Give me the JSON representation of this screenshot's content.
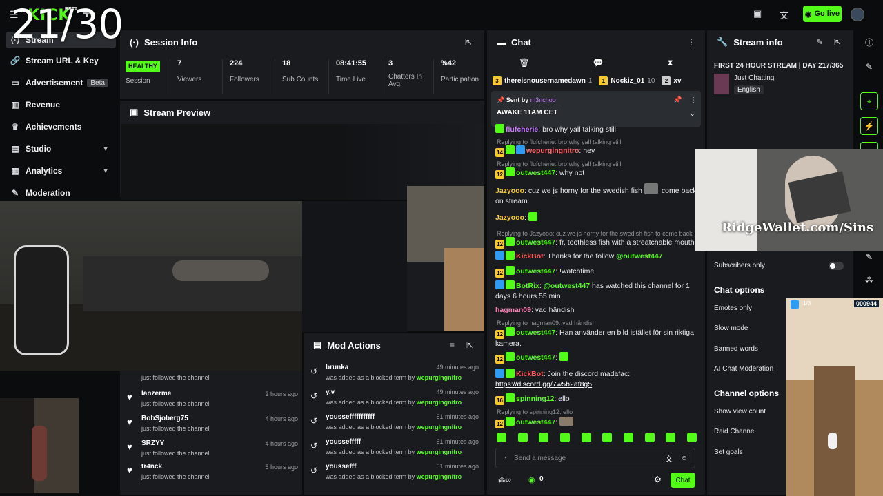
{
  "topbar": {
    "logo": "KICK",
    "beta": "BETA",
    "go_live": "Go live"
  },
  "overlay_counter": "21/30",
  "sidebar": {
    "items": [
      {
        "label": "Stream",
        "icon": "stream-icon"
      },
      {
        "label": "Stream URL & Key",
        "icon": "link-icon"
      },
      {
        "label": "Advertisement",
        "icon": "ad-icon",
        "badge": "Beta"
      },
      {
        "label": "Revenue",
        "icon": "chart-icon"
      },
      {
        "label": "Achievements",
        "icon": "trophy-icon"
      },
      {
        "label": "Studio",
        "icon": "studio-icon"
      },
      {
        "label": "Analytics",
        "icon": "analytics-icon"
      },
      {
        "label": "Moderation",
        "icon": "moderation-icon"
      }
    ]
  },
  "session": {
    "title": "Session Info",
    "status": "HEALTHY",
    "stats": [
      {
        "value": "",
        "label": "Session"
      },
      {
        "value": "7",
        "label": "Viewers"
      },
      {
        "value": "224",
        "label": "Followers"
      },
      {
        "value": "18",
        "label": "Sub Counts"
      },
      {
        "value": "08:41:55",
        "label": "Time Live"
      },
      {
        "value": "3",
        "label": "Chatters In Avg."
      },
      {
        "value": "%42",
        "label": "Participation"
      }
    ]
  },
  "preview": {
    "title": "Stream Preview"
  },
  "follows": [
    {
      "name": "",
      "sub": "just followed the channel",
      "time": ""
    },
    {
      "name": "lanzerme",
      "sub": "just followed the channel",
      "time": "2 hours ago"
    },
    {
      "name": "BobSjoberg75",
      "sub": "just followed the channel",
      "time": "4 hours ago"
    },
    {
      "name": "SRZYY",
      "sub": "just followed the channel",
      "time": "4 hours ago"
    },
    {
      "name": "tr4nck",
      "sub": "just followed the channel",
      "time": "5 hours ago"
    }
  ],
  "mod_actions": {
    "title": "Mod Actions",
    "items": [
      {
        "term": "brunka",
        "desc": "was added as a blocked term by",
        "by": "wepurgingnitro",
        "time": "49 minutes ago"
      },
      {
        "term": "y.v",
        "desc": "was added as a blocked term by",
        "by": "wepurgingnitro",
        "time": "49 minutes ago"
      },
      {
        "term": "youssefffffffffff",
        "desc": "was added as a blocked term by",
        "by": "wepurgingnitro",
        "time": "51 minutes ago"
      },
      {
        "term": "youssefffff",
        "desc": "was added as a blocked term by",
        "by": "wepurgingnitro",
        "time": "51 minutes ago"
      },
      {
        "term": "youssefff",
        "desc": "was added as a blocked term by",
        "by": "wepurgingnitro",
        "time": "51 minutes ago"
      }
    ]
  },
  "chat": {
    "title": "Chat",
    "gifters": [
      {
        "name": "thereisnousernamedawn",
        "count": "1"
      },
      {
        "name": "Nockiz_01",
        "count": "10"
      },
      {
        "name": "xv",
        "count": ""
      }
    ],
    "pinned": {
      "sent_by": "Sent by",
      "user": "m3nchoo",
      "text": "AWAKE 11AM CET"
    },
    "messages": [
      {
        "user": "flufcherie",
        "text": "bro why yall talking still",
        "reply": ""
      },
      {
        "user": "wepurgingnitro",
        "text": "hey",
        "reply": "Replying to flufcherie: bro why yall talking still"
      },
      {
        "user": "outwest447",
        "text": "why not",
        "reply": "Replying to flufcherie: bro why yall talking still"
      },
      {
        "user": "Jazyooo",
        "text": "cuz we js horny for the swedish fish",
        "text2": "come back on stream",
        "reply": ""
      },
      {
        "user": "Jazyooo",
        "text": "",
        "reply": ""
      },
      {
        "user": "outwest447",
        "text": "fr, toothless fish with a streatchable mouth",
        "reply": "Replying to Jazyooo: cuz we js horny for the swedish fish to come back"
      },
      {
        "user": "KickBot",
        "text": "Thanks for the follow",
        "mention": "@outwest447",
        "reply": ""
      },
      {
        "user": "outwest447",
        "text": "!watchtime",
        "reply": ""
      },
      {
        "user": "BotRix",
        "text": "has watched this channel for 1 days 6 hours 55 min.",
        "mention": "@outwest447",
        "reply": ""
      },
      {
        "user": "hagman09",
        "text": "vad händish",
        "reply": ""
      },
      {
        "user": "outwest447",
        "text": "Han använder en bild istället för sin riktiga kamera.",
        "reply": "Replying to hagman09: vad händish"
      },
      {
        "user": "outwest447",
        "text": "",
        "reply": ""
      },
      {
        "user": "KickBot",
        "text": "Join the discord madafac:",
        "link": "https://discord.gg/7w5b2af8g5",
        "reply": ""
      },
      {
        "user": "spinning12",
        "text": "ello",
        "reply": ""
      },
      {
        "user": "outwest447",
        "text": "",
        "reply": "Replying to spinning12: ello"
      }
    ],
    "badges": {
      "b1": "14",
      "b2": "12",
      "b3": "16"
    },
    "input_placeholder": "Send a message",
    "viewers_count": "0",
    "send_label": "Chat"
  },
  "stream_info": {
    "title": "Stream info",
    "stream_title": "FIRST 24 HOUR STREAM | DAY 217/365",
    "category": "Just Chatting",
    "tag": "English",
    "subs_only": "Subscribers only",
    "chat_options_head": "Chat options",
    "chat_options": [
      "Emotes only",
      "Slow mode",
      "Banned words",
      "AI Chat Moderation"
    ],
    "channel_options_head": "Channel options",
    "channel_options": [
      "Show view count",
      "Raid Channel",
      "Set goals"
    ]
  },
  "ridge_ad": "RidgeWallet.com/Sins",
  "game_hud": {
    "score": "000944",
    "multiplier": "1/3"
  },
  "colors": {
    "accent": "#53fc18",
    "panel": "#191b1f",
    "bg": "#0b0c0d"
  }
}
